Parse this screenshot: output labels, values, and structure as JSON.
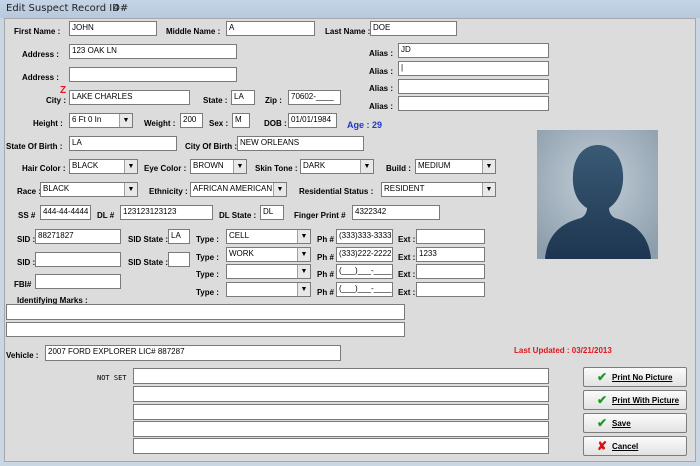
{
  "title": {
    "text": "Edit Suspect Record ID#",
    "id": "4"
  },
  "labels": {
    "first_name": "First Name :",
    "middle_name": "Middle Name :",
    "last_name": "Last Name :",
    "address1": "Address :",
    "address2": "Address :",
    "city": "City :",
    "state": "State :",
    "zip": "Zip :",
    "alias1": "Alias :",
    "alias2": "Alias :",
    "alias3": "Alias :",
    "alias4": "Alias :",
    "height": "Height :",
    "weight": "Weight :",
    "sex": "Sex :",
    "dob": "DOB :",
    "state_of_birth": "State Of Birth :",
    "city_of_birth": "City Of Birth :",
    "hair_color": "Hair Color :",
    "eye_color": "Eye Color :",
    "skin_tone": "Skin Tone :",
    "build": "Build :",
    "race": "Race :",
    "ethnicity": "Ethnicity :",
    "residential_status": "Residential Status :",
    "ss": "SS #",
    "dl": "DL #",
    "dl_state": "DL State :",
    "finger_print": "Finger Print #",
    "sid1": "SID :",
    "sid_state1": "SID State :",
    "sid2": "SID :",
    "sid_state2": "SID State :",
    "fbi": "FBI#",
    "type1": "Type :",
    "type2": "Type :",
    "type3": "Type :",
    "type4": "Type :",
    "ph1": "Ph #",
    "ph2": "Ph #",
    "ph3": "Ph #",
    "ph4": "Ph #",
    "ext1": "Ext :",
    "ext2": "Ext :",
    "ext3": "Ext :",
    "ext4": "Ext :",
    "identifying_marks": "Identifying Marks :",
    "vehicle": "Vehicle :",
    "not_set": "NOT SET"
  },
  "values": {
    "first_name": "JOHN",
    "middle_name": "A",
    "last_name": "DOE",
    "address1": "123 OAK LN",
    "address2": "",
    "city": "LAKE CHARLES",
    "state": "LA",
    "zip": "70602-____",
    "alias1": "JD",
    "alias2": "|",
    "alias3": "",
    "alias4": "",
    "height": "6 Ft 0 In",
    "weight": "200",
    "sex": "M",
    "dob": "01/01/1984",
    "state_of_birth": "LA",
    "city_of_birth": "NEW ORLEANS",
    "hair_color": "BLACK",
    "eye_color": "BROWN",
    "skin_tone": "DARK",
    "build": "MEDIUM",
    "race": "BLACK",
    "ethnicity": "AFRICAN AMERICAN",
    "residential_status": "RESIDENT",
    "ss": "444-44-4444",
    "dl": "123123123123",
    "dl_state": "DL",
    "finger_print": "4322342",
    "sid1": "88271827",
    "sid_state1": "LA",
    "sid2": "",
    "sid_state2": "",
    "fbi": "",
    "type1": "CELL",
    "type2": "WORK",
    "type3": "",
    "type4": "",
    "ph1": "(333)333-3333",
    "ph2": "(333)222-2222",
    "ph3": "(___)___-____",
    "ph4": "(___)___-____",
    "ext1": "",
    "ext2": "1233",
    "ext3": "",
    "ext4": "",
    "marks1": "",
    "marks2": "",
    "vehicle": "2007 FORD EXPLORER LIC# 887287",
    "notes": [
      "",
      "",
      "",
      "",
      ""
    ]
  },
  "age": "Age : 29",
  "last_updated": "Last Updated : 03/21/2013",
  "city_marker": "Z",
  "buttons": {
    "print_no_picture": "Print No Picture",
    "print_with_picture": "Print With Picture",
    "save": "Save",
    "cancel": "Cancel"
  },
  "icons": {
    "print_no_picture": "check-icon",
    "print_with_picture": "check-icon",
    "save": "check-icon",
    "cancel": "x-icon",
    "combo": "chevron-down-icon",
    "photo": "person-silhouette-icon"
  },
  "colors": {
    "age": "#1f37c9",
    "last_updated": "#e0161c",
    "check": "#1e9a24",
    "cancel_x": "#d21414"
  }
}
